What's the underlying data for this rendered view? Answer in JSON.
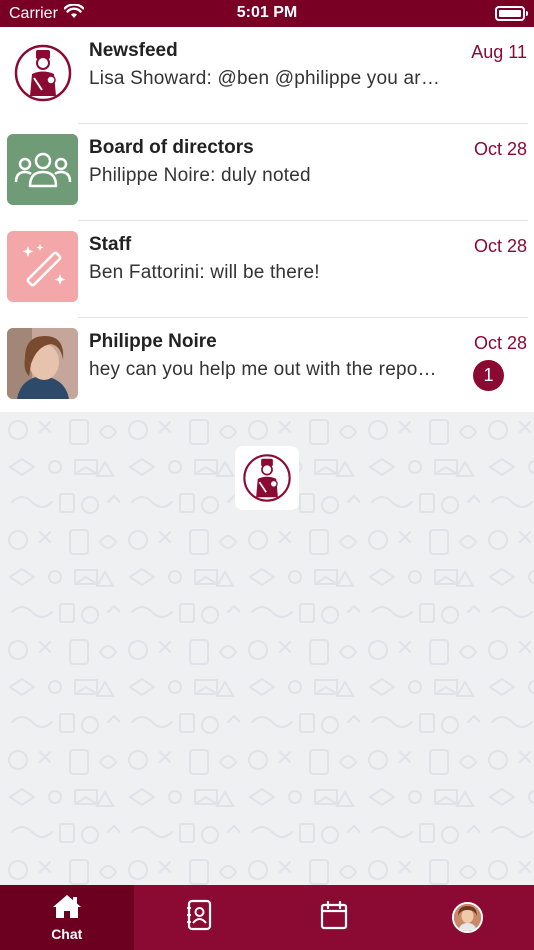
{
  "status_bar": {
    "carrier": "Carrier",
    "time": "5:01 PM"
  },
  "chats": [
    {
      "name": "Newsfeed",
      "preview": "Lisa Showard: @ben @philippe you are …",
      "date": "Aug 11",
      "avatar": "doorman-logo-icon",
      "badge": null
    },
    {
      "name": "Board of directors",
      "preview": "Philippe Noire: duly noted",
      "date": "Oct 28",
      "avatar": "group-icon",
      "avatar_color": "#6f9c76",
      "badge": null
    },
    {
      "name": "Staff",
      "preview": "Ben Fattorini: will be there!",
      "date": "Oct 28",
      "avatar": "magic-wand-icon",
      "avatar_color": "#f3a7a9",
      "badge": null
    },
    {
      "name": "Philippe Noire",
      "preview": "hey can you help me out with the repo…",
      "date": "Oct 28",
      "avatar": "user-photo",
      "badge": "1"
    }
  ],
  "tab_bar": {
    "tabs": [
      {
        "id": "chat",
        "label": "Chat",
        "icon": "home-icon",
        "active": true
      },
      {
        "id": "contacts",
        "label": "",
        "icon": "contacts-icon",
        "active": false
      },
      {
        "id": "calendar",
        "label": "",
        "icon": "calendar-icon",
        "active": false
      },
      {
        "id": "profile",
        "label": "",
        "icon": "profile-avatar",
        "active": false
      }
    ]
  },
  "colors": {
    "brand": "#8b0a33",
    "status_bar": "#790024",
    "active_tab": "#6b0020",
    "pattern_bg": "#eef0f2"
  }
}
